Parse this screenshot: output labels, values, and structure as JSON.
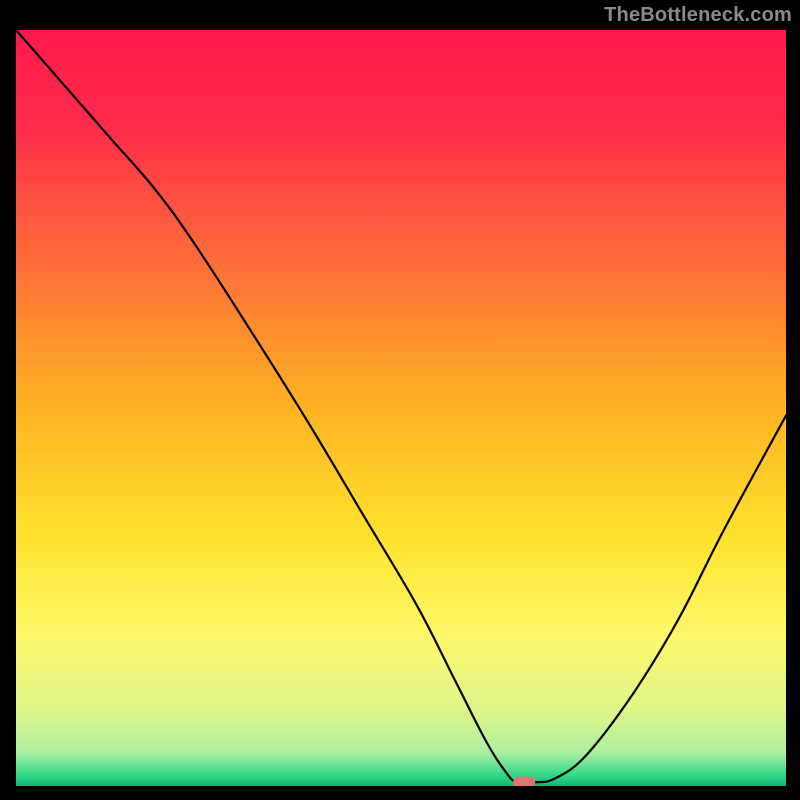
{
  "watermark": "TheBottleneck.com",
  "chart_data": {
    "type": "line",
    "title": "",
    "xlabel": "",
    "ylabel": "",
    "xlim": [
      0,
      100
    ],
    "ylim": [
      0,
      100
    ],
    "grid": false,
    "legend": false,
    "background": {
      "type": "vertical-gradient",
      "stops": [
        {
          "pos": 0.0,
          "color": "#ff1a4d"
        },
        {
          "pos": 0.12,
          "color": "#ff2a4a"
        },
        {
          "pos": 0.3,
          "color": "#ff6a3a"
        },
        {
          "pos": 0.5,
          "color": "#ffb321"
        },
        {
          "pos": 0.68,
          "color": "#ffe42f"
        },
        {
          "pos": 0.8,
          "color": "#fff86a"
        },
        {
          "pos": 0.9,
          "color": "#dff58a"
        },
        {
          "pos": 0.955,
          "color": "#aef0a0"
        },
        {
          "pos": 0.985,
          "color": "#35d98a"
        },
        {
          "pos": 1.0,
          "color": "#0fb873"
        }
      ]
    },
    "series": [
      {
        "name": "bottleneck-curve",
        "color": "#000000",
        "x": [
          0,
          6,
          12,
          18,
          23,
          30,
          38,
          45,
          52,
          57,
          61,
          63.5,
          65,
          67.5,
          70,
          74,
          80,
          86,
          92,
          100
        ],
        "y": [
          100,
          93,
          86,
          79,
          72,
          61,
          48,
          36,
          24,
          14,
          6,
          2,
          0.5,
          0.5,
          1,
          4,
          12,
          22,
          34,
          49
        ]
      }
    ],
    "marker": {
      "name": "optimal-point",
      "x": 66,
      "y": 0.5,
      "color": "#e0766f",
      "shape": "pill"
    }
  }
}
